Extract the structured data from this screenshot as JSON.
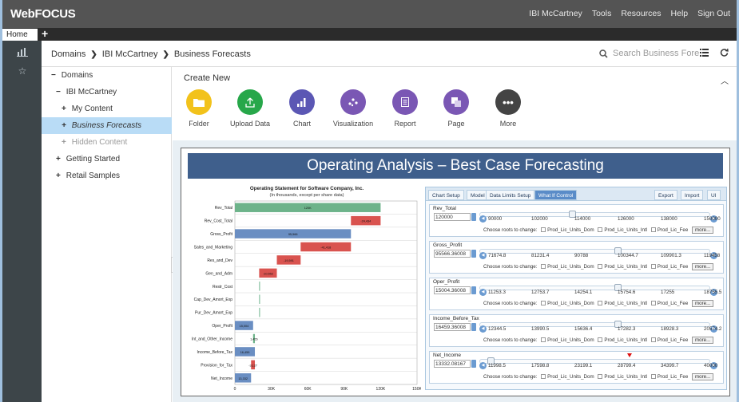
{
  "app": {
    "logo": "WebFOCUS"
  },
  "topnav": [
    "IBI McCartney",
    "Tools",
    "Resources",
    "Help",
    "Sign Out"
  ],
  "tabs": {
    "home": "Home",
    "add": "+"
  },
  "breadcrumb": {
    "items": [
      "Domains",
      "IBI McCartney",
      "Business Forecasts"
    ]
  },
  "search": {
    "placeholder": "Search Business Fore..."
  },
  "tree": [
    {
      "label": "Domains",
      "marker": "−"
    },
    {
      "label": "IBI McCartney",
      "marker": "−"
    },
    {
      "label": "My Content",
      "marker": "+"
    },
    {
      "label": "Business Forecasts",
      "marker": "+"
    },
    {
      "label": "Hidden Content",
      "marker": "+"
    },
    {
      "label": "Getting Started",
      "marker": "+"
    },
    {
      "label": "Retail Samples",
      "marker": "+"
    }
  ],
  "create": {
    "title": "Create New",
    "items": [
      {
        "label": "Folder",
        "color": "#f2c21b",
        "icon": "folder-icon"
      },
      {
        "label": "Upload Data",
        "color": "#27a74a",
        "icon": "upload-icon"
      },
      {
        "label": "Chart",
        "color": "#5b57b4",
        "icon": "chart-icon"
      },
      {
        "label": "Visualization",
        "color": "#7a57b4",
        "icon": "visualization-icon"
      },
      {
        "label": "Report",
        "color": "#7a57b4",
        "icon": "report-icon"
      },
      {
        "label": "Page",
        "color": "#7a57b4",
        "icon": "page-icon"
      },
      {
        "label": "More",
        "color": "#444444",
        "icon": "more-icon"
      }
    ]
  },
  "report": {
    "title": "Operating Analysis – Best Case Forecasting"
  },
  "chart_data": {
    "type": "bar",
    "subtype": "waterfall",
    "title": "Operating Statement for Software Company, Inc.",
    "subtitle": "(In thousands, except per share data)",
    "categories": [
      "Rev_Total",
      "Rev_Cost_Total",
      "Gross_Profit",
      "Sales_and_Marketing",
      "Res_and_Dev",
      "Gen_and_Adm",
      "Restr_Cost",
      "Cap_Dev_Amort_Exp",
      "Pur_Dev_Amort_Exp",
      "Oper_Profit",
      "Int_and_Other_Income",
      "Income_Before_Tax",
      "Provision_for_Tax",
      "Net_Income"
    ],
    "start": [
      0,
      120000,
      0,
      95566,
      54148,
      34557,
      20004,
      20004,
      20004,
      0,
      15004,
      0,
      16459,
      0
    ],
    "end": [
      120000,
      95566,
      95566,
      54148,
      34557,
      20004,
      20004,
      20004,
      20004,
      15004,
      16459,
      16459,
      13332,
      13332
    ],
    "labels": [
      "120K",
      "-24,434",
      "95,566",
      "-41,418",
      "-19,591",
      "-10,552",
      "",
      "",
      "",
      "15,004",
      "1,455",
      "16,459",
      "-3,127",
      "13,332"
    ],
    "colors": [
      "#6db38a",
      "#d9534f",
      "#6a8ec2",
      "#d9534f",
      "#d9534f",
      "#d9534f",
      "#6db38a",
      "#6db38a",
      "#6db38a",
      "#6a8ec2",
      "#6db38a",
      "#6a8ec2",
      "#d9534f",
      "#6a8ec2"
    ],
    "xticks": [
      "0",
      "30K",
      "60K",
      "90K",
      "120K",
      "150K"
    ],
    "xlim": [
      0,
      150000
    ]
  },
  "whatif": {
    "tabs": [
      "Chart Setup",
      "Model",
      "Data Limits Setup",
      "What If Control"
    ],
    "right_tabs": [
      "Export",
      "Import",
      "UI"
    ],
    "roots_label": "Choose roots to change:",
    "roots": [
      "Prod_Lic_Units_Dom",
      "Prod_Lic_Units_Intl",
      "Prod_Lic_Fee"
    ],
    "more": "more...",
    "groups": [
      {
        "name": "Rev_Total",
        "value": "120000",
        "ticks": [
          "90000",
          "102000",
          "114000",
          "126000",
          "138000",
          "150000"
        ],
        "thumb": 0.4
      },
      {
        "name": "Gross_Profit",
        "value": "95566.36008",
        "ticks": [
          "71674.8",
          "81231.4",
          "90788",
          "100344.7",
          "109901.3",
          "119458"
        ],
        "thumb": 0.6
      },
      {
        "name": "Oper_Profit",
        "value": "15004.36008",
        "ticks": [
          "11253.3",
          "12753.7",
          "14254.1",
          "15754.6",
          "17255",
          "18755.5"
        ],
        "thumb": 0.6
      },
      {
        "name": "Income_Before_Tax",
        "value": "16459.36008",
        "ticks": [
          "12344.5",
          "13990.5",
          "15636.4",
          "17282.3",
          "18928.3",
          "20574.2"
        ],
        "thumb": 0.6
      },
      {
        "name": "Net_Income",
        "value": "13332.08167",
        "ticks": [
          "11998.5",
          "17598.8",
          "23199.1",
          "28799.4",
          "34399.7",
          "40000"
        ],
        "thumb": 0.05
      }
    ]
  }
}
